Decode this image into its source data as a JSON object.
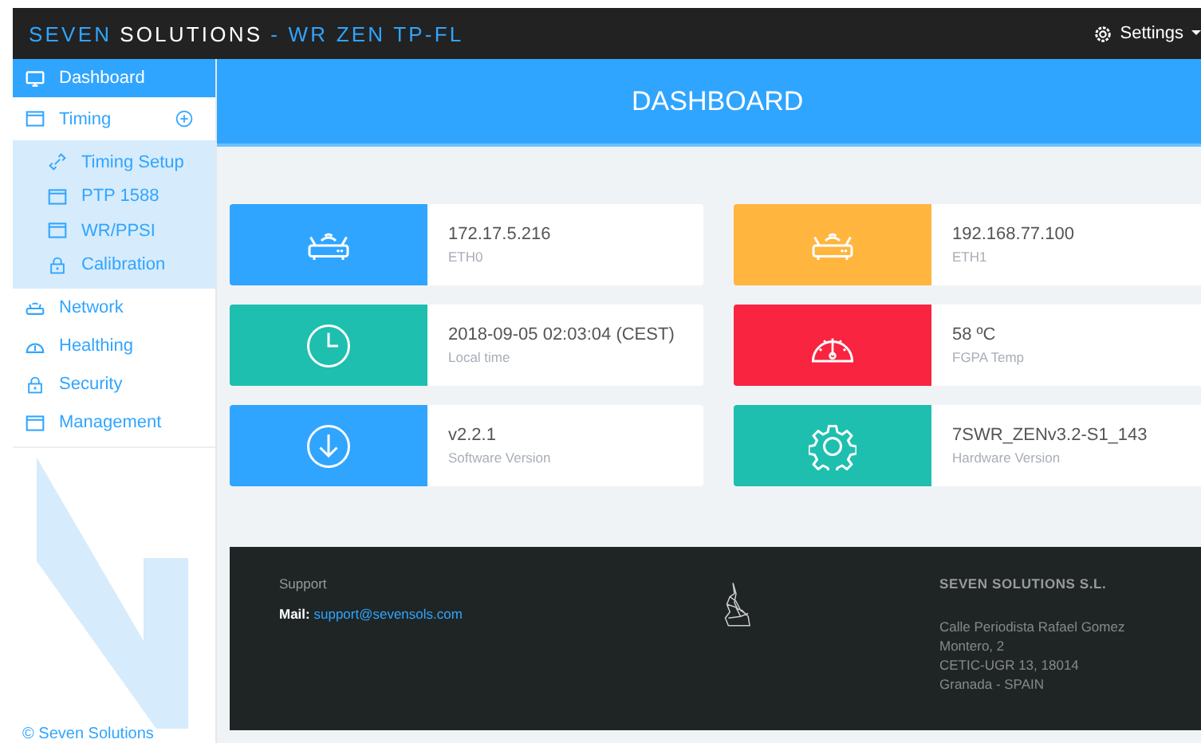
{
  "header": {
    "brand": [
      {
        "text": "SEVEN",
        "accent": true
      },
      {
        "text": "SOLUTIONS",
        "accent": false
      },
      {
        "text": "- WR ZEN TP-FL",
        "accent": true
      }
    ],
    "settings": "Settings"
  },
  "sidebar": {
    "items": [
      {
        "label": "Dashboard",
        "selected": true
      },
      {
        "label": "Timing",
        "selected": false,
        "expanded": true,
        "children": [
          {
            "label": "Timing Setup"
          },
          {
            "label": "PTP 1588"
          },
          {
            "label": "WR/PPSI"
          },
          {
            "label": "Calibration"
          }
        ]
      },
      {
        "label": "Network",
        "selected": false
      },
      {
        "label": "Healthing",
        "selected": false
      },
      {
        "label": "Security",
        "selected": false
      },
      {
        "label": "Management",
        "selected": false
      }
    ],
    "copyright": "© Seven Solutions"
  },
  "banner": {
    "title": "DASHBOARD"
  },
  "cards": [
    {
      "value": "172.17.5.216",
      "label": "ETH0",
      "color": "#30a5ff"
    },
    {
      "value": "192.168.77.100",
      "label": "ETH1",
      "color": "#ffb53e"
    },
    {
      "value": "2018-09-05 02:03:04 (CEST)",
      "label": "Local time",
      "color": "#1ebfae"
    },
    {
      "value": "58 ºC",
      "label": "FGPA Temp",
      "color": "#f9243f"
    },
    {
      "value": "v2.2.1",
      "label": "Software Version",
      "color": "#30a5ff"
    },
    {
      "value": "7SWR_ZENv3.2-S1_143",
      "label": "Hardware Version",
      "color": "#1ebfae"
    }
  ],
  "footer": {
    "support_title": "Support",
    "mail_label": "Mail:",
    "mail": "support@sevensols.com",
    "company": "SEVEN SOLUTIONS S.L.",
    "address": [
      "Calle Periodista Rafael Gomez",
      "Montero, 2",
      "CETIC-UGR 13, 18014",
      "Granada - SPAIN"
    ]
  }
}
